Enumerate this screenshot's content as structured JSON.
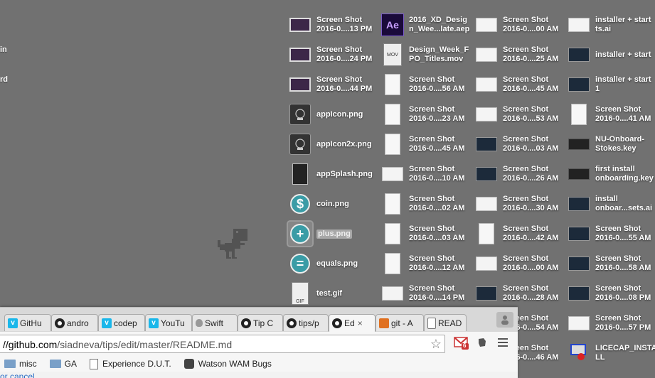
{
  "left_fragments": [
    "in",
    "rd"
  ],
  "columns": [
    {
      "items": [
        {
          "label": "Screen Shot\n2016-0....13 PM",
          "thumb": "ss-purple"
        },
        {
          "label": "Screen Shot\n2016-0....24 PM",
          "thumb": "ss-purple"
        },
        {
          "label": "Screen Shot\n2016-0....44 PM",
          "thumb": "ss-purple"
        },
        {
          "label": "appIcon.png",
          "thumb": "appicon"
        },
        {
          "label": "appIcon2x.png",
          "thumb": "appicon"
        },
        {
          "label": "appSplash.png",
          "thumb": "ss-tall-dark"
        },
        {
          "label": "coin.png",
          "thumb": "circle",
          "glyph": "$"
        },
        {
          "label": "plus.png",
          "thumb": "circle",
          "glyph": "+",
          "selected": true
        },
        {
          "label": "equals.png",
          "thumb": "circle",
          "glyph": "="
        },
        {
          "label": "test.gif",
          "thumb": "gif"
        }
      ]
    },
    {
      "items": [
        {
          "label": "2016_XD_Desig\nn_Wee...late.aep",
          "thumb": "ae",
          "glyph": "Ae"
        },
        {
          "label": "Design_Week_F\nPO_Titles.mov",
          "thumb": "mov",
          "glyph": "MOV"
        },
        {
          "label": "Screen Shot\n2016-0....56 AM",
          "thumb": "ss-tall"
        },
        {
          "label": "Screen Shot\n2016-0....23 AM",
          "thumb": "ss-tall"
        },
        {
          "label": "Screen Shot\n2016-0....45 AM",
          "thumb": "ss-tall"
        },
        {
          "label": "Screen Shot\n2016-0....10 AM",
          "thumb": "ss-white"
        },
        {
          "label": "Screen Shot\n2016-0....02 AM",
          "thumb": "ss-tall"
        },
        {
          "label": "Screen Shot\n2016-0....03 AM",
          "thumb": "ss-tall"
        },
        {
          "label": "Screen Shot\n2016-0....12 AM",
          "thumb": "ss-tall"
        },
        {
          "label": "Screen Shot\n2016-0....14 PM",
          "thumb": "ss-white"
        }
      ]
    },
    {
      "items": [
        {
          "label": "Screen Shot\n2016-0....00 AM",
          "thumb": "ss-white"
        },
        {
          "label": "Screen Shot\n2016-0....25 AM",
          "thumb": "ss-white"
        },
        {
          "label": "Screen Shot\n2016-0....45 AM",
          "thumb": "ss-white"
        },
        {
          "label": "Screen Shot\n2016-0....53 AM",
          "thumb": "ss-white"
        },
        {
          "label": "Screen Shot\n2016-0....03 AM",
          "thumb": "ss-dark"
        },
        {
          "label": "Screen Shot\n2016-0....26 AM",
          "thumb": "ss-dark"
        },
        {
          "label": "Screen Shot\n2016-0....30 AM",
          "thumb": "ss-white"
        },
        {
          "label": "Screen Shot\n2016-0....42 AM",
          "thumb": "ss-tall"
        },
        {
          "label": "Screen Shot\n2016-0....00 AM",
          "thumb": "ss-white"
        },
        {
          "label": "Screen Shot\n2016-0....28 AM",
          "thumb": "ss-dark"
        },
        {
          "label": "Screen Shot\n2016-0....54 AM",
          "thumb": "ss-white"
        },
        {
          "label": "Screen Shot\n2016-0....46 AM",
          "thumb": "ss-white"
        }
      ]
    },
    {
      "items": [
        {
          "label": "installer + start\nts.ai",
          "thumb": "ss-white"
        },
        {
          "label": "installer + start",
          "thumb": "ss-dark"
        },
        {
          "label": "installer + start\n1",
          "thumb": "ss-dark"
        },
        {
          "label": "Screen Shot\n2016-0....41 AM",
          "thumb": "ss-tall"
        },
        {
          "label": "NU-Onboard-\nStokes.key",
          "thumb": "key"
        },
        {
          "label": "first install\nonboarding.key",
          "thumb": "key"
        },
        {
          "label": "install\nonboar...sets.ai",
          "thumb": "ss-dark"
        },
        {
          "label": "Screen Shot\n2016-0....55 AM",
          "thumb": "ss-dark"
        },
        {
          "label": "Screen Shot\n2016-0....58 AM",
          "thumb": "ss-dark"
        },
        {
          "label": "Screen Shot\n2016-0....08 PM",
          "thumb": "ss-dark"
        },
        {
          "label": "Screen Shot\n2016-0....57 PM",
          "thumb": "ss-white"
        },
        {
          "label": "LICECAP_INSTA\nLL",
          "thumb": "licecap"
        }
      ]
    }
  ],
  "browser": {
    "tabs": [
      {
        "label": "GitHu",
        "icon": "vimeo"
      },
      {
        "label": "andro",
        "icon": "github"
      },
      {
        "label": "codep",
        "icon": "vimeo"
      },
      {
        "label": "YouTu",
        "icon": "vimeo"
      },
      {
        "label": "Swift",
        "icon": "apple"
      },
      {
        "label": "Tip C",
        "icon": "github"
      },
      {
        "label": "tips/p",
        "icon": "github"
      },
      {
        "label": "Ed",
        "icon": "github",
        "active": true,
        "close": "×"
      },
      {
        "label": "git - A",
        "icon": "rss"
      },
      {
        "label": "READ",
        "icon": "page"
      }
    ],
    "url_host": "//github.com",
    "url_path": "/siadneva/tips/edit/master/README.md",
    "gmail_count": "6",
    "bookmarks": [
      {
        "label": "misc",
        "icon": "folder"
      },
      {
        "label": "GA",
        "icon": "folder"
      },
      {
        "label": "Experience D.U.T.",
        "icon": "page"
      },
      {
        "label": "Watson WAM Bugs",
        "icon": "gear"
      }
    ],
    "cancel_link": "or cancel"
  }
}
